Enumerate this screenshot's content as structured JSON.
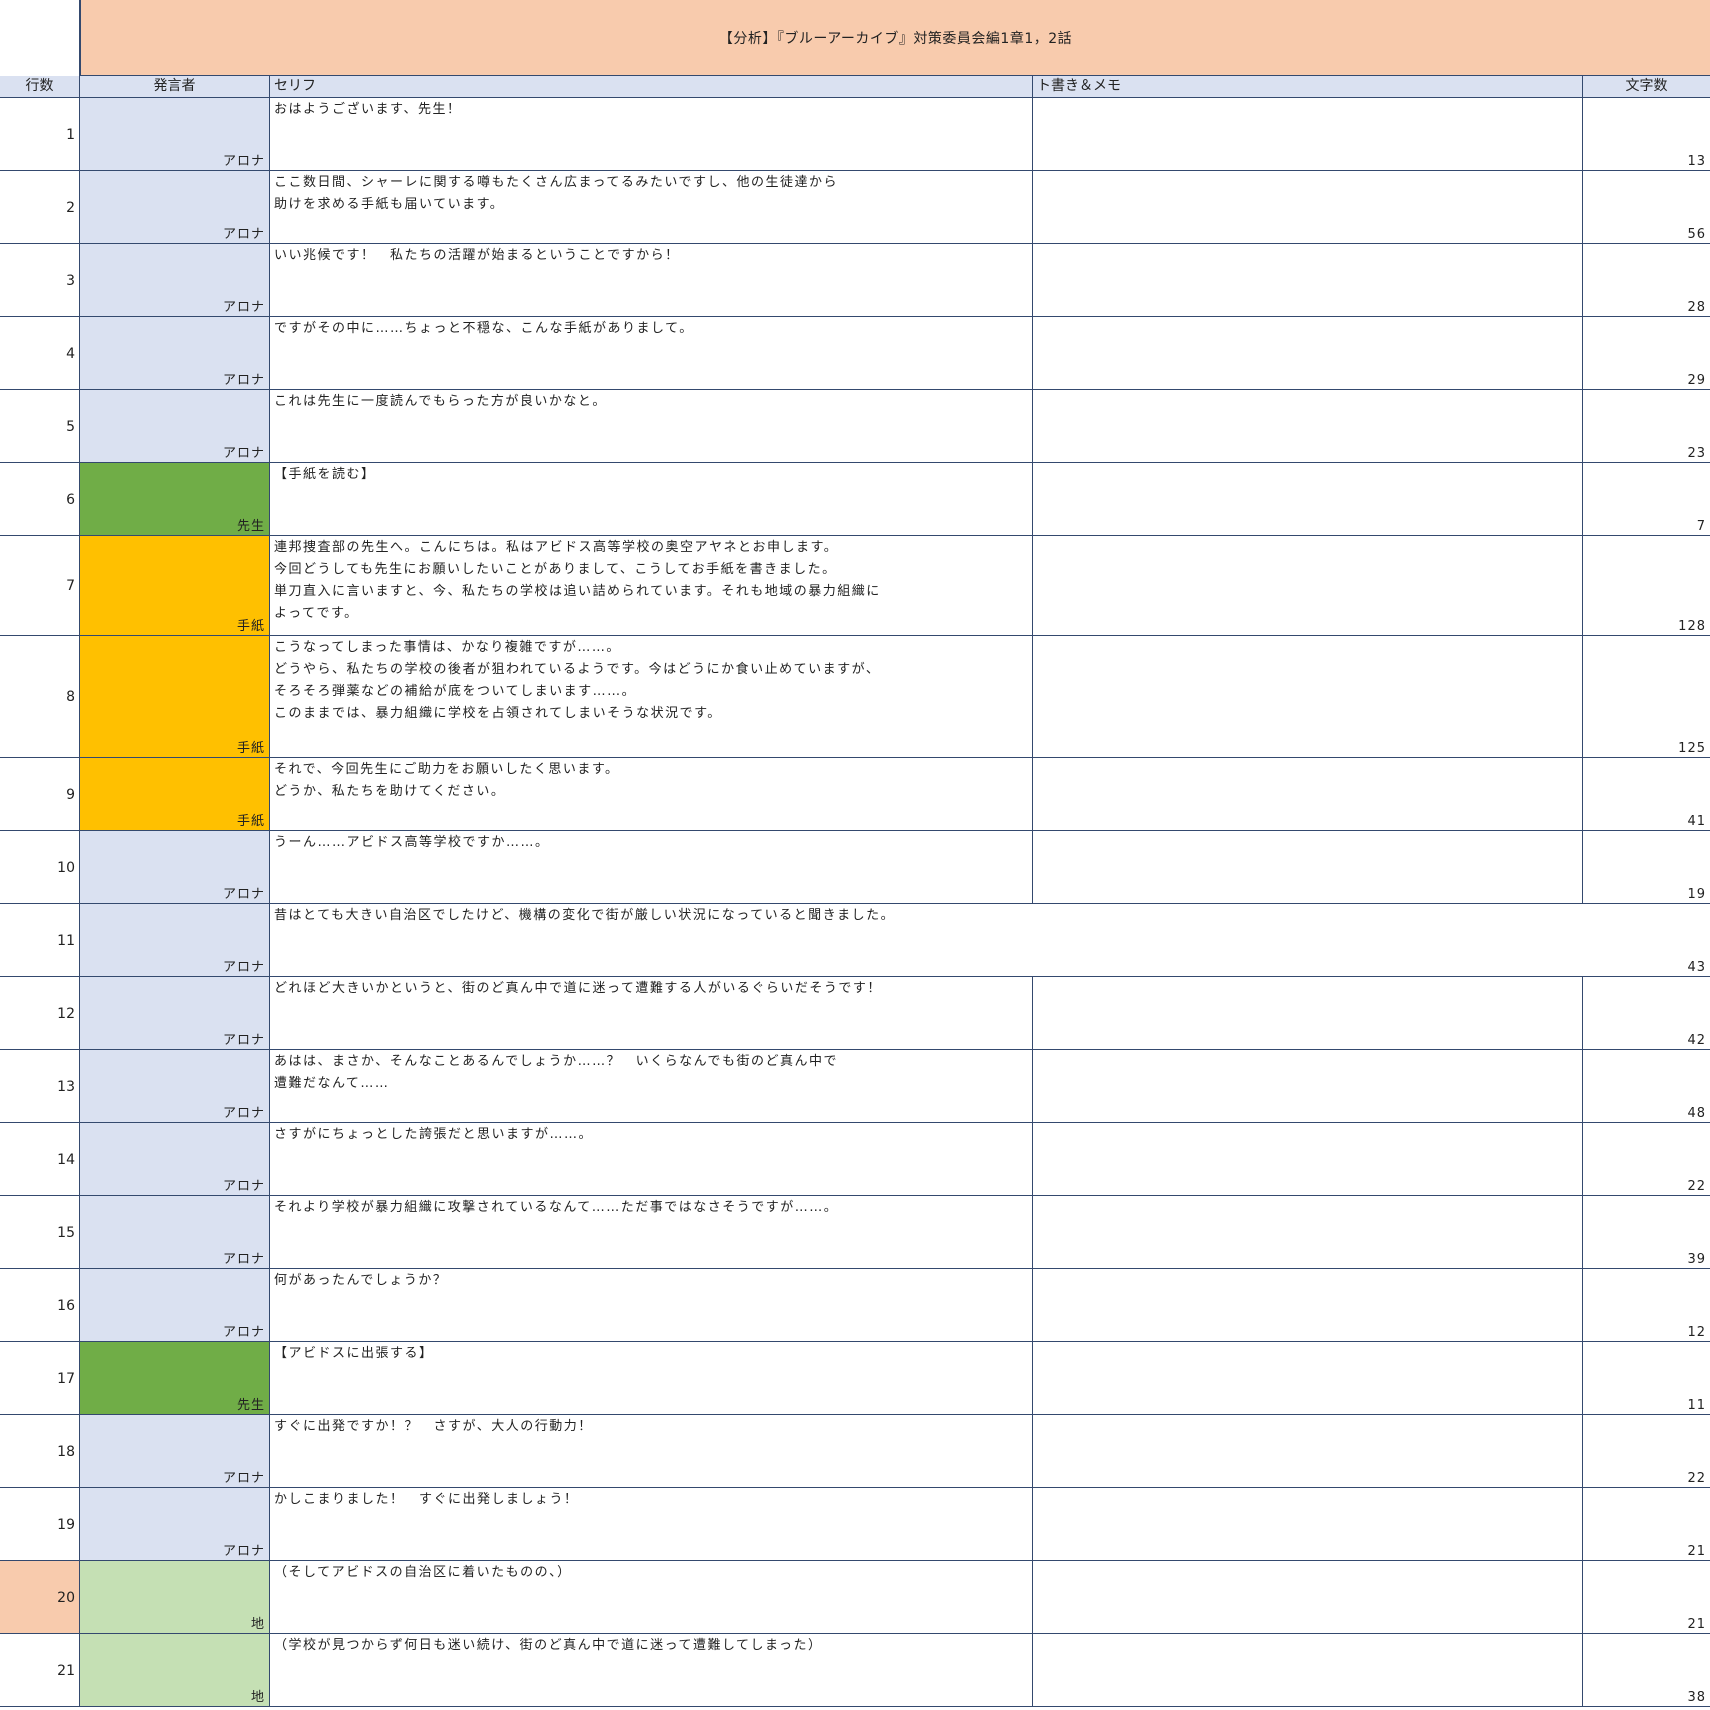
{
  "title": "【分析】『ブルーアーカイブ』対策委員会編1章1，2話",
  "headers": {
    "row": "行数",
    "speaker": "発言者",
    "line": "セリフ",
    "memo": "ト書き＆メモ",
    "count": "文字数"
  },
  "speaker_colors": {
    "アロナ": "#dae1f1",
    "先生": "#70ad47",
    "手紙": "#ffc000",
    "地": "#c5e0b4"
  },
  "rows": [
    {
      "n": "1",
      "speaker": "アロナ",
      "text": "おはようございます、先生！",
      "count": "13"
    },
    {
      "n": "2",
      "speaker": "アロナ",
      "text": "ここ数日間、シャーレに関する噂もたくさん広まってるみたいですし、他の生徒達から\n助けを求める手紙も届いています。",
      "count": "56"
    },
    {
      "n": "3",
      "speaker": "アロナ",
      "text": "いい兆候です！　私たちの活躍が始まるということですから！",
      "count": "28"
    },
    {
      "n": "4",
      "speaker": "アロナ",
      "text": "ですがその中に……ちょっと不穏な、こんな手紙がありまして。",
      "count": "29"
    },
    {
      "n": "5",
      "speaker": "アロナ",
      "text": "これは先生に一度読んでもらった方が良いかなと。",
      "count": "23"
    },
    {
      "n": "6",
      "speaker": "先生",
      "text": "【手紙を読む】",
      "count": "7"
    },
    {
      "n": "7",
      "speaker": "手紙",
      "text": "連邦捜査部の先生へ。こんにちは。私はアビドス高等学校の奥空アヤネとお申します。\n今回どうしても先生にお願いしたいことがありまして、こうしてお手紙を書きました。\n単刀直入に言いますと、今、私たちの学校は追い詰められています。それも地域の暴力組織に\nよってです。",
      "count": "128"
    },
    {
      "n": "8",
      "speaker": "手紙",
      "text": "こうなってしまった事情は、かなり複雑ですが……。\nどうやら、私たちの学校の後者が狙われているようです。今はどうにか食い止めていますが、\nそろそろ弾薬などの補給が底をついてしまいます……。\nこのままでは、暴力組織に学校を占領されてしまいそうな状況です。",
      "count": "125"
    },
    {
      "n": "9",
      "speaker": "手紙",
      "text": "それで、今回先生にご助力をお願いしたく思います。\nどうか、私たちを助けてください。",
      "count": "41"
    },
    {
      "n": "10",
      "speaker": "アロナ",
      "text": "うーん……アビドス高等学校ですか……。",
      "count": "19"
    },
    {
      "n": "11",
      "speaker": "アロナ",
      "text": "昔はとても大きい自治区でしたけど、機構の変化で街が厳しい状況になっていると聞きました。",
      "count": "43"
    },
    {
      "n": "12",
      "speaker": "アロナ",
      "text": "どれほど大きいかというと、街のど真ん中で道に迷って遭難する人がいるぐらいだそうです！",
      "count": "42"
    },
    {
      "n": "13",
      "speaker": "アロナ",
      "text": "あはは、まさか、そんなことあるんでしょうか……？　いくらなんでも街のど真ん中で\n遭難だなんて……",
      "count": "48"
    },
    {
      "n": "14",
      "speaker": "アロナ",
      "text": "さすがにちょっとした誇張だと思いますが……。",
      "count": "22"
    },
    {
      "n": "15",
      "speaker": "アロナ",
      "text": "それより学校が暴力組織に攻撃されているなんて……ただ事ではなさそうですが……。",
      "count": "39"
    },
    {
      "n": "16",
      "speaker": "アロナ",
      "text": "何があったんでしょうか？",
      "count": "12"
    },
    {
      "n": "17",
      "speaker": "先生",
      "text": "【アビドスに出張する】",
      "count": "11"
    },
    {
      "n": "18",
      "speaker": "アロナ",
      "text": "すぐに出発ですか！？　さすが、大人の行動力！",
      "count": "22"
    },
    {
      "n": "19",
      "speaker": "アロナ",
      "text": "かしこまりました！　すぐに出発しましょう！",
      "count": "21"
    },
    {
      "n": "20",
      "speaker": "地",
      "text": "（そしてアビドスの自治区に着いたものの、）",
      "count": "21",
      "rownum_color": "#f8cbad"
    },
    {
      "n": "21",
      "speaker": "地",
      "text": "（学校が見つからず何日も迷い続け、街のど真ん中で道に迷って遭難してしまった）",
      "count": "38"
    }
  ]
}
